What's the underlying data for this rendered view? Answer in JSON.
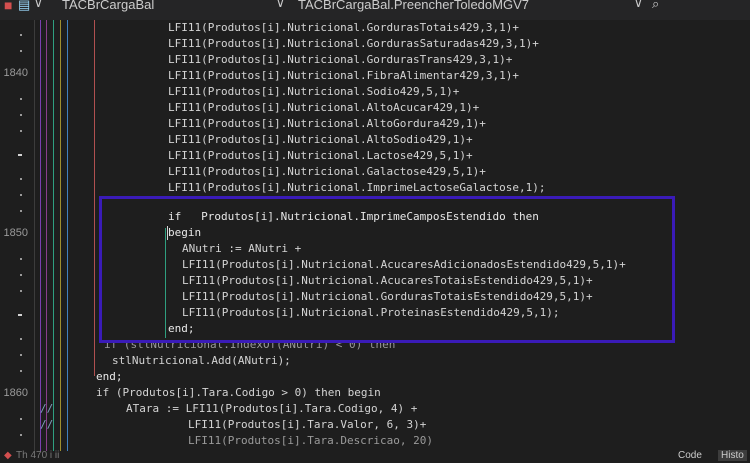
{
  "topbar": {
    "file_tab": "TACBrCargaBal",
    "breadcrumb": "TACBrCargaBal.PreencherToledoMGV7"
  },
  "gutter": {
    "line_numbers": [
      "1840",
      "1850",
      "1860"
    ]
  },
  "code": {
    "lines": [
      "LFI11(Produtos[i].Nutricional.GordurasTotais429,3,1)+",
      "LFI11(Produtos[i].Nutricional.GordurasSaturadas429,3,1)+",
      "LFI11(Produtos[i].Nutricional.GordurasTrans429,3,1)+",
      "LFI11(Produtos[i].Nutricional.FibraAlimentar429,3,1)+",
      "LFI11(Produtos[i].Nutricional.Sodio429,5,1)+",
      "LFI11(Produtos[i].Nutricional.AltoAcucar429,1)+",
      "LFI11(Produtos[i].Nutricional.AltoGordura429,1)+",
      "LFI11(Produtos[i].Nutricional.AltoSodio429,1)+",
      "LFI11(Produtos[i].Nutricional.Lactose429,5,1)+",
      "LFI11(Produtos[i].Nutricional.Galactose429,5,1)+",
      "LFI11(Produtos[i].Nutricional.ImprimeLactoseGalactose,1);",
      "",
      "if   Produtos[i].Nutricional.ImprimeCamposEstendido then",
      "begin",
      "ANutri := ANutri +",
      "LFI11(Produtos[i].Nutricional.AcucaresAdicionadosEstendido429,5,1)+",
      "LFI11(Produtos[i].Nutricional.AcucaresTotaisEstendido429,5,1)+",
      "LFI11(Produtos[i].Nutricional.GordurasTotaisEstendido429,5,1)+",
      "LFI11(Produtos[i].Nutricional.ProteinasEstendido429,5,1);",
      "end;",
      "if (stlNutricional.IndexOf(ANutri) < 0) then",
      "stlNutricional.Add(ANutri);",
      "end;",
      "if (Produtos[i].Tara.Codigo > 0) then begin",
      "ATara := LFI11(Produtos[i].Tara.Codigo, 4) +",
      "LFI11(Produtos[i].Tara.Valor, 6, 3)+",
      "LFI11(Produtos[i].Tara.Descricao, 20)"
    ],
    "comment_markers": [
      "//",
      "//"
    ]
  },
  "statusbar": {
    "left_text": "Th           470     i    ii",
    "code_tab": "Code",
    "history_tab": "Histo"
  },
  "colors": {
    "background": "#1e1e1e",
    "highlight_box": "#3a1bb8",
    "text": "#d4d4d4"
  }
}
